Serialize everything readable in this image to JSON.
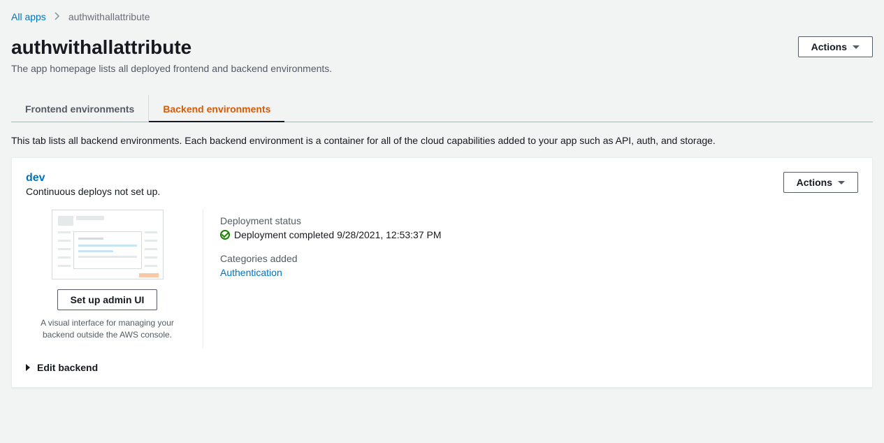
{
  "breadcrumb": {
    "root": "All apps",
    "current": "authwithallattribute"
  },
  "header": {
    "title": "authwithallattribute",
    "subtitle": "The app homepage lists all deployed frontend and backend environments.",
    "actions_label": "Actions"
  },
  "tabs": {
    "frontend": "Frontend environments",
    "backend": "Backend environments",
    "description": "This tab lists all backend environments. Each backend environment is a container for all of the cloud capabilities added to your app such as API, auth, and storage."
  },
  "env": {
    "name": "dev",
    "subtitle": "Continuous deploys not set up.",
    "actions_label": "Actions",
    "setup_button": "Set up admin UI",
    "setup_desc": "A visual interface for managing your backend outside the AWS console.",
    "deploy_label": "Deployment status",
    "deploy_text": "Deployment completed 9/28/2021, 12:53:37 PM",
    "categories_label": "Categories added",
    "category_link": "Authentication",
    "edit_label": "Edit backend"
  }
}
